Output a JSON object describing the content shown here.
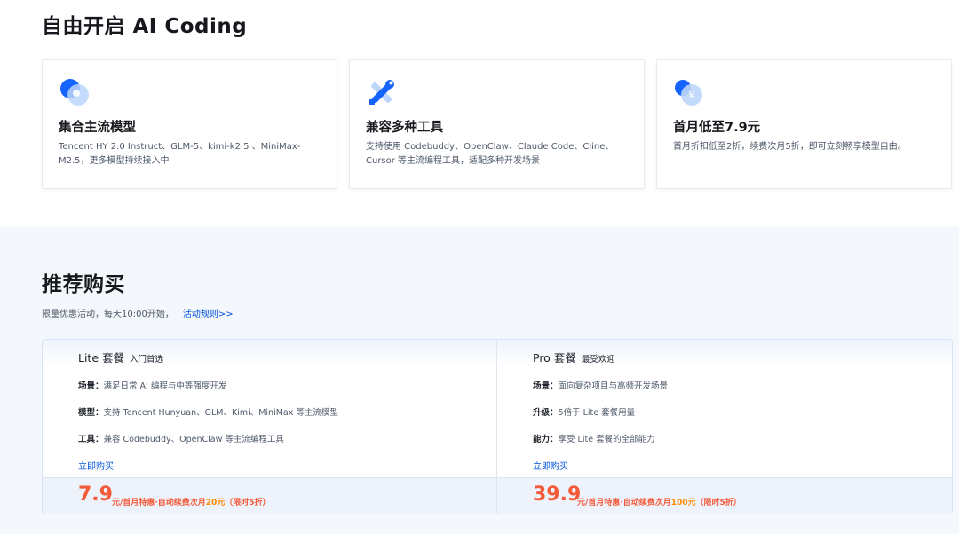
{
  "intro": {
    "title": "自由开启 AI Coding",
    "features": [
      {
        "icon": "model-icon",
        "title": "集合主流模型",
        "desc": "Tencent HY 2.0 Instruct、GLM-5、kimi-k2.5 、MiniMax-M2.5，更多模型持续接入中"
      },
      {
        "icon": "tools-icon",
        "title": "兼容多种工具",
        "desc": "支持使用 Codebuddy、OpenClaw、Claude Code、Cline、Cursor 等主流编程工具，适配多种开发场景"
      },
      {
        "icon": "yuan-icon",
        "title": "首月低至7.9元",
        "desc": "首月折扣低至2折，续费次月5折，即可立刻畅享模型自由。"
      }
    ]
  },
  "recommend": {
    "title": "推荐购买",
    "subtitle": "限量优惠活动，每天10:00开始，",
    "rules_link": "活动规则>>"
  },
  "plans": [
    {
      "name": "Lite 套餐",
      "tag": "入门首选",
      "rows": [
        {
          "label": "场景",
          "text": "满足日常 AI 编程与中等强度开发"
        },
        {
          "label": "模型",
          "text": "支持 Tencent Hunyuan、GLM、Kimi、MiniMax 等主流模型"
        },
        {
          "label": "工具",
          "text": "兼容 Codebuddy、OpenClaw 等主流编程工具"
        }
      ],
      "buy_label": "立即购买",
      "price": "7.9",
      "note_prefix": "元/首月特惠·自动续费次月",
      "note_highlight": "20元",
      "note_suffix": "（限时5折）"
    },
    {
      "name": "Pro 套餐",
      "tag": "最受欢迎",
      "rows": [
        {
          "label": "场景",
          "text": "面向复杂项目与高频开发场景"
        },
        {
          "label": "升级",
          "text": "5倍于 Lite 套餐用量"
        },
        {
          "label": "能力",
          "text": "享受 Lite 套餐的全部能力"
        }
      ],
      "buy_label": "立即购买",
      "price": "39.9",
      "note_prefix": "元/首月特惠·自动续费次月",
      "note_highlight": "100元",
      "note_suffix": "（限时5折）"
    }
  ],
  "colors": {
    "accent": "#0052d9",
    "price": "#f35a3a",
    "highlight": "#ff8a00"
  }
}
